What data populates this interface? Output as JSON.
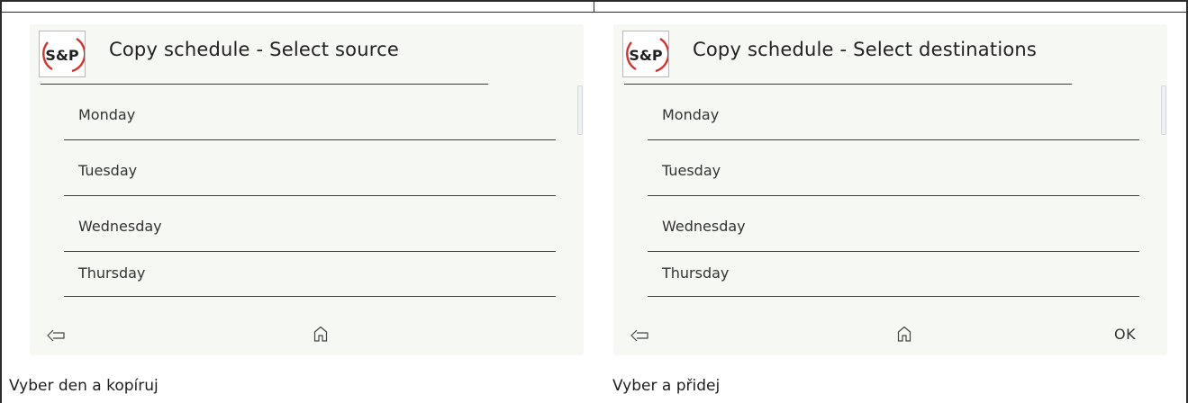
{
  "brand": {
    "logo_text": "S&P",
    "accent_color": "#d6302a"
  },
  "panels": [
    {
      "title": "Copy schedule - Select source",
      "days": [
        "Monday",
        "Tuesday",
        "Wednesday",
        "Thursday"
      ],
      "nav": {
        "back_icon": "back-arrow-icon",
        "home_icon": "home-icon"
      },
      "caption": "Vyber den a kopíruj"
    },
    {
      "title": "Copy schedule - Select destinations",
      "days": [
        "Monday",
        "Tuesday",
        "Wednesday",
        "Thursday"
      ],
      "nav": {
        "back_icon": "back-arrow-icon",
        "home_icon": "home-icon",
        "ok_label": "OK"
      },
      "caption": "Vyber a přidej"
    }
  ]
}
